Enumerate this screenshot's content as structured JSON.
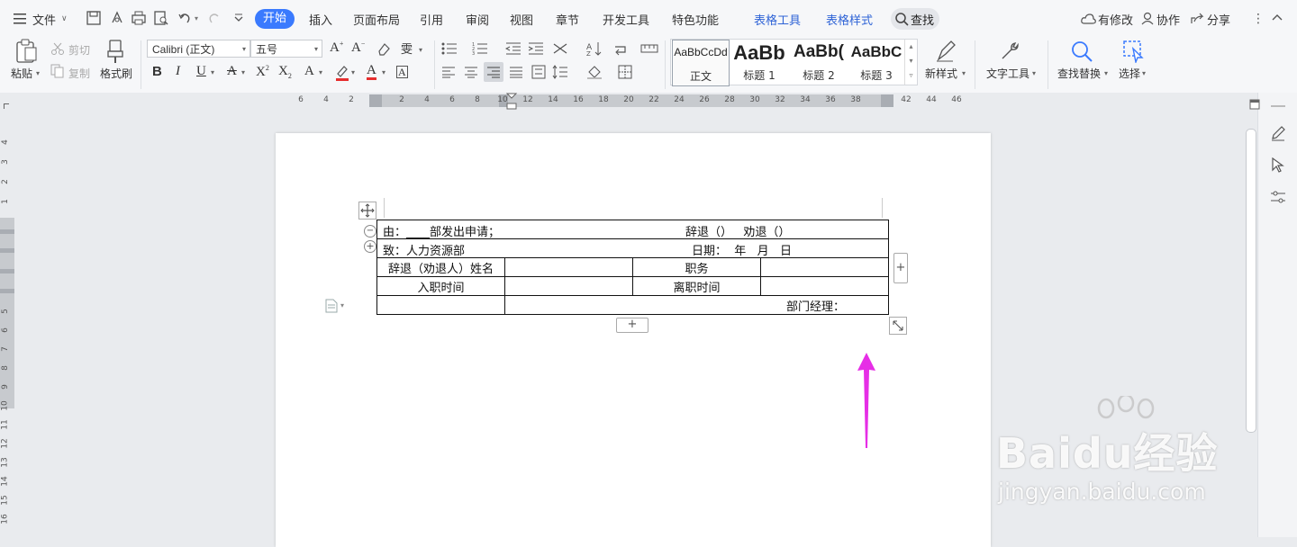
{
  "menubar": {
    "file_label": "文件",
    "tabs": [
      "开始",
      "插入",
      "页面布局",
      "引用",
      "审阅",
      "视图",
      "章节",
      "开发工具",
      "特色功能"
    ],
    "context_tabs": [
      "表格工具",
      "表格样式"
    ],
    "search_label": "查找",
    "has_changes_label": "有修改",
    "collab_label": "协作",
    "share_label": "分享"
  },
  "ribbon": {
    "paste_label": "粘贴",
    "cut_label": "剪切",
    "copy_label": "复制",
    "format_painter_label": "格式刷",
    "font_name": "Calibri (正文)",
    "font_size": "五号",
    "styles": [
      {
        "sample": "AaBbCcDd",
        "name": "正文"
      },
      {
        "sample": "AaBb",
        "name": "标题 1"
      },
      {
        "sample": "AaBb(",
        "name": "标题 2"
      },
      {
        "sample": "AaBbC",
        "name": "标题 3"
      }
    ],
    "new_style_label": "新样式",
    "text_tools_label": "文字工具",
    "find_replace_label": "查找替换",
    "select_label": "选择"
  },
  "ruler": {
    "h_numbers": [
      "6",
      "4",
      "2",
      "2",
      "4",
      "6",
      "8",
      "10",
      "12",
      "14",
      "16",
      "18",
      "20",
      "22",
      "24",
      "26",
      "28",
      "30",
      "32",
      "34",
      "36",
      "38",
      "42",
      "44",
      "46"
    ],
    "v_numbers": [
      "4",
      "3",
      "2",
      "1",
      "5",
      "6",
      "7",
      "8",
      "9",
      "10",
      "11",
      "12",
      "13",
      "14",
      "15",
      "16"
    ]
  },
  "document": {
    "rows": [
      {
        "left": "由：____部发出申请；",
        "right": "辞退（）   劝退（）"
      },
      {
        "left": "致：人力资源部",
        "right": "日期：  年   月   日"
      }
    ],
    "grid": [
      [
        "辞退（劝退人）姓名",
        "",
        "职务",
        ""
      ],
      [
        "入职时间",
        "",
        "离职时间",
        ""
      ]
    ],
    "manager_label": "部门经理："
  },
  "colors": {
    "accent": "#3a7afe",
    "annotation_arrow": "#e62ee6"
  },
  "watermark": {
    "brand": "Baidu经验",
    "url": "jingyan.baidu.com"
  }
}
